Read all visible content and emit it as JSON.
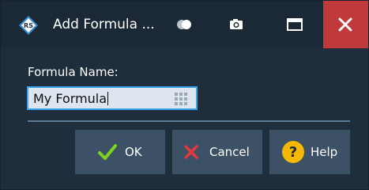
{
  "window": {
    "title": "Add Formula ...",
    "icon": "rohde-schwarz-logo"
  },
  "titlebar": {
    "toggle_icon": "toggle-icon",
    "camera_icon": "camera-icon",
    "maximize_icon": "maximize-icon",
    "close_icon": "close-icon",
    "close_color": "#c0393b"
  },
  "form": {
    "name_label": "Formula Name:",
    "name_value": "My Formula",
    "keypad_icon": "keypad-icon"
  },
  "buttons": {
    "ok_label": "OK",
    "cancel_label": "Cancel",
    "help_label": "Help"
  },
  "colors": {
    "background": "#1f2e3d",
    "button": "#3c5166",
    "focus": "#3aa3e8",
    "ok_check": "#7ed321",
    "cancel_x": "#e5363a",
    "help_circle": "#f5b800"
  }
}
